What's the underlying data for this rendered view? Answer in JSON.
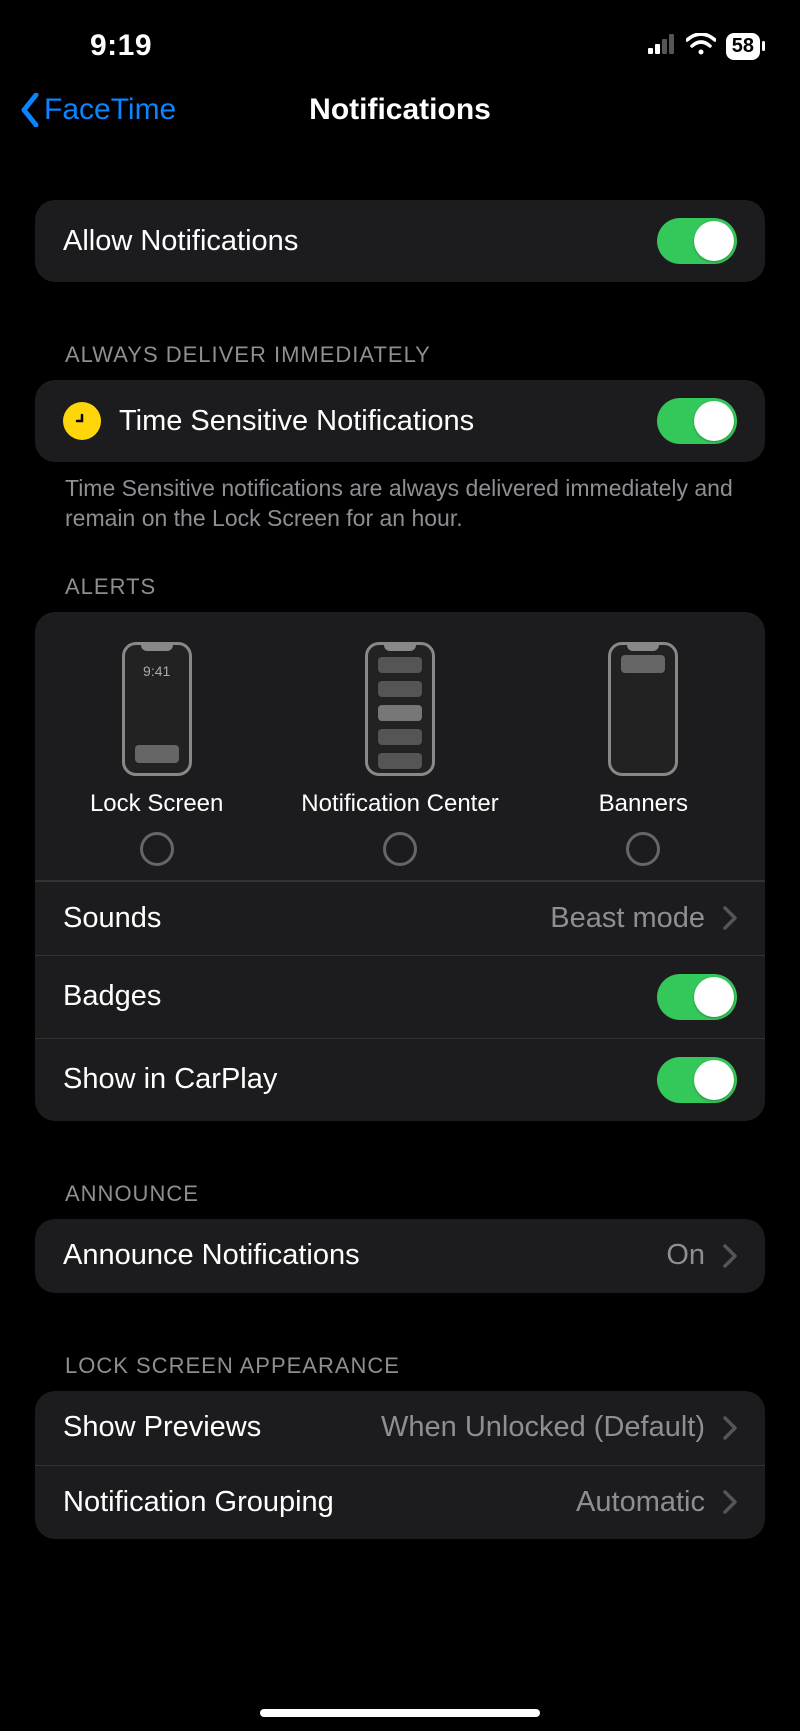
{
  "status": {
    "time": "9:19",
    "battery": "58"
  },
  "nav": {
    "back": "FaceTime",
    "title": "Notifications"
  },
  "sections": {
    "allow": {
      "label": "Allow Notifications"
    },
    "ts_header": "ALWAYS DELIVER IMMEDIATELY",
    "ts": {
      "label": "Time Sensitive Notifications"
    },
    "ts_footer": "Time Sensitive notifications are always delivered immediately and remain on the Lock Screen for an hour.",
    "alerts_header": "ALERTS",
    "alerts": {
      "lock": {
        "label": "Lock Screen",
        "mock_time": "9:41"
      },
      "nc": {
        "label": "Notification Center"
      },
      "ban": {
        "label": "Banners"
      }
    },
    "sounds": {
      "label": "Sounds",
      "value": "Beast mode"
    },
    "badges": {
      "label": "Badges"
    },
    "carplay": {
      "label": "Show in CarPlay"
    },
    "announce_header": "ANNOUNCE",
    "announce": {
      "label": "Announce Notifications",
      "value": "On"
    },
    "ls_header": "LOCK SCREEN APPEARANCE",
    "previews": {
      "label": "Show Previews",
      "value": "When Unlocked (Default)"
    },
    "grouping": {
      "label": "Notification Grouping",
      "value": "Automatic"
    }
  }
}
